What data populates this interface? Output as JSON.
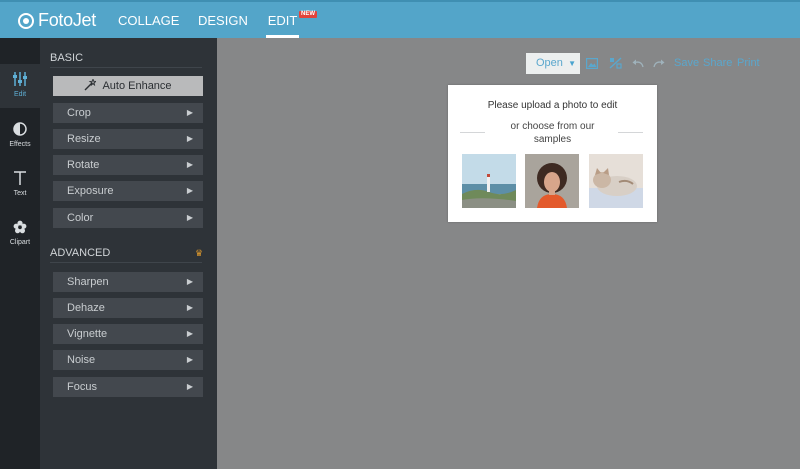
{
  "app": {
    "brand": "FotoJet"
  },
  "nav": {
    "tabs": [
      {
        "label": "COLLAGE"
      },
      {
        "label": "DESIGN"
      },
      {
        "label": "EDIT",
        "badge": "NEW"
      }
    ],
    "active_tab": "EDIT"
  },
  "rail": [
    {
      "label": "Edit",
      "icon": "sliders-icon",
      "active": true
    },
    {
      "label": "Effects",
      "icon": "contrast-circle-icon"
    },
    {
      "label": "Text",
      "icon": "text-t-icon"
    },
    {
      "label": "Clipart",
      "icon": "flower-icon"
    }
  ],
  "basic": {
    "title": "BASIC",
    "auto_enhance": "Auto Enhance",
    "items": [
      "Crop",
      "Resize",
      "Rotate",
      "Exposure",
      "Color"
    ]
  },
  "advanced": {
    "title": "ADVANCED",
    "items": [
      "Sharpen",
      "Dehaze",
      "Vignette",
      "Noise",
      "Focus"
    ]
  },
  "toolbar": {
    "open": "Open",
    "save": "Save",
    "share": "Share",
    "print": "Print"
  },
  "dialog": {
    "title": "Please upload a photo to edit",
    "subtitle": "or choose from our samples",
    "samples": [
      "lighthouse-coast",
      "woman-with-hat",
      "cat-on-blanket"
    ]
  },
  "colors": {
    "topbar": "#53a5c9",
    "rail": "#1f2327",
    "panel": "#2e3338",
    "canvas": "#868788",
    "accent": "#5aa7cd",
    "new_badge": "#e2433b"
  }
}
